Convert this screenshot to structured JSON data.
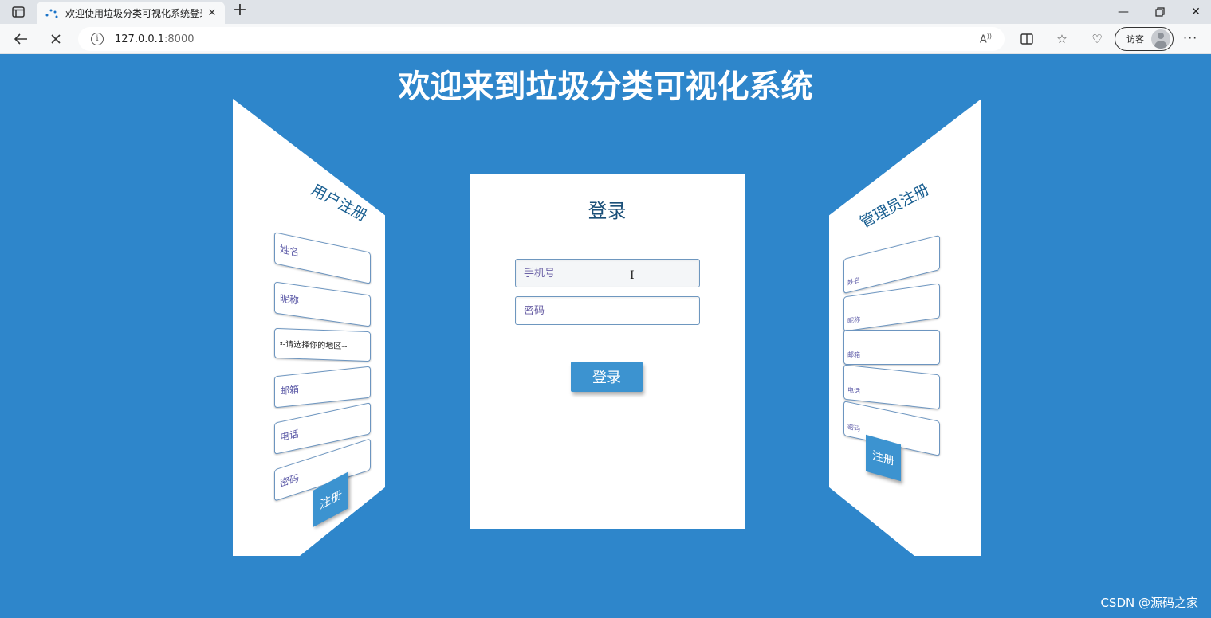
{
  "browser": {
    "tab_title": "欢迎使用垃圾分类可视化系统登录",
    "new_tab_icon": "plus-icon",
    "address_host": "127.0.0.1",
    "address_port": ":8000",
    "guest_label": "访客"
  },
  "page": {
    "title": "欢迎来到垃圾分类可视化系统"
  },
  "user_register": {
    "title": "用户注册",
    "fields": [
      "姓名",
      "昵称",
      "邮箱",
      "电话",
      "密码"
    ],
    "region_select": "--请选择你的地区--",
    "submit_label": "注册"
  },
  "login": {
    "title": "登录",
    "phone_placeholder": "手机号",
    "password_placeholder": "密码",
    "submit_label": "登录"
  },
  "admin_register": {
    "title": "管理员注册",
    "fields": [
      "姓名",
      "昵称",
      "邮箱",
      "电话",
      "密码"
    ],
    "submit_label": "注册"
  },
  "watermark": "CSDN @源码之家",
  "colors": {
    "background": "#2e86cb",
    "button": "#3c93d0",
    "title_text": "#1a5f91"
  }
}
